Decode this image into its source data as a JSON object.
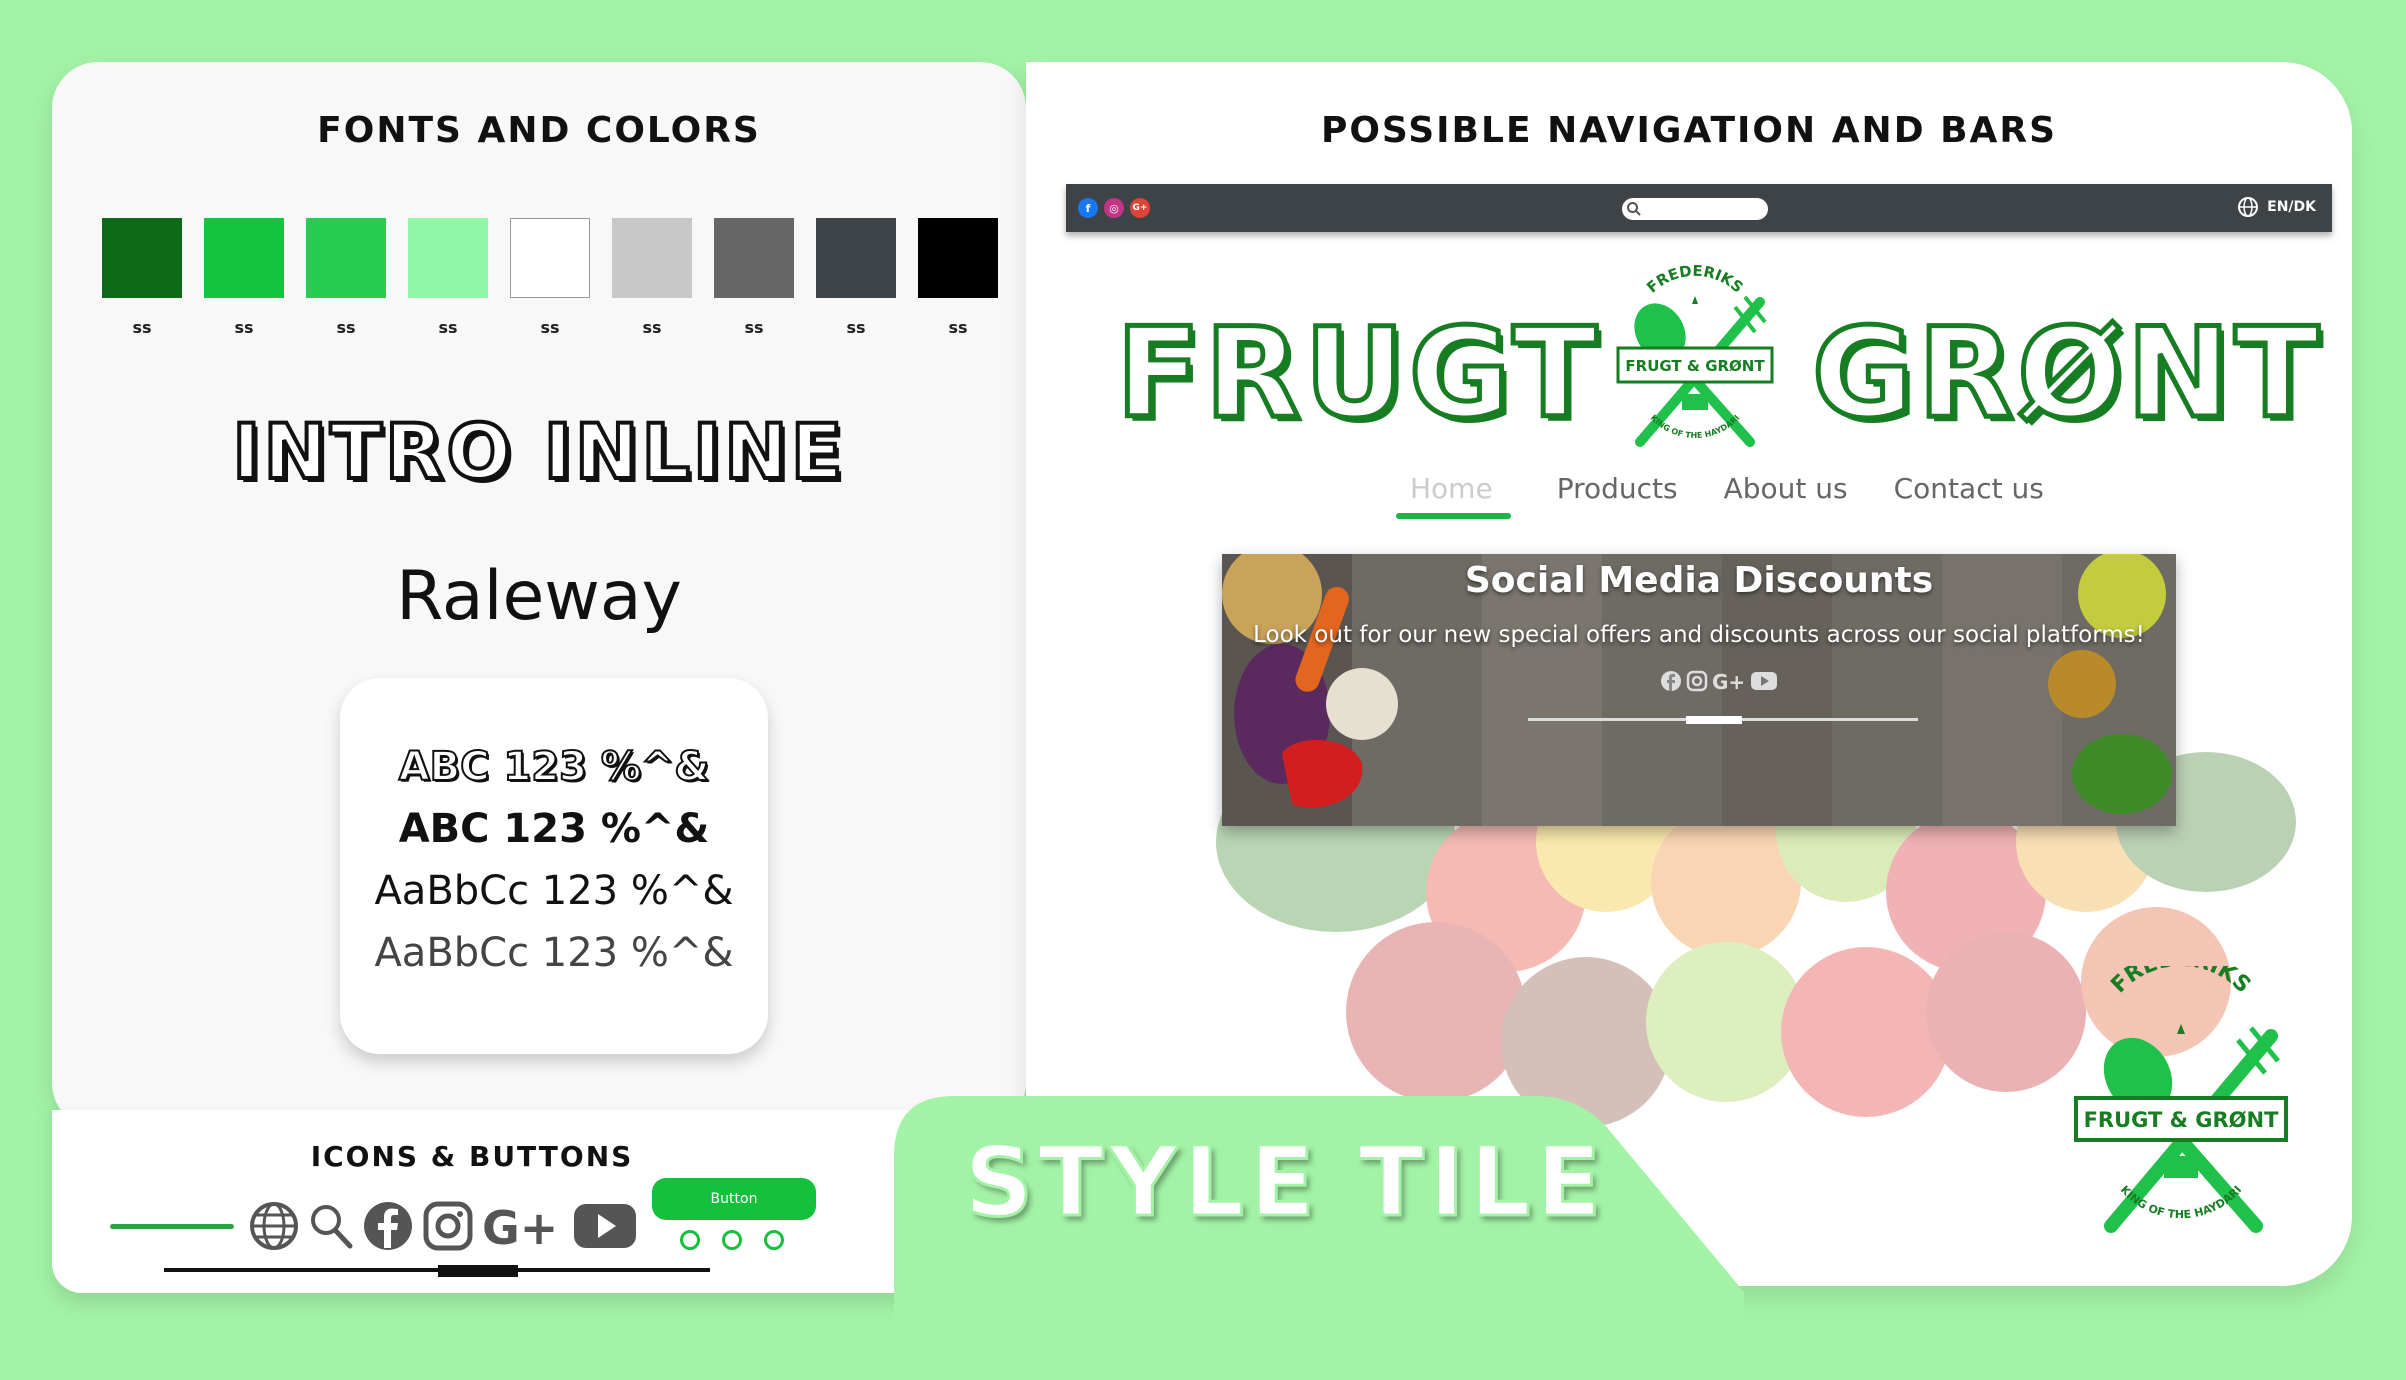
{
  "fonts_panel": {
    "title": "FONTS AND COLORS",
    "swatches": [
      {
        "color": "#0e6a17",
        "label": "ss"
      },
      {
        "color": "#14c43c",
        "label": "ss"
      },
      {
        "color": "#27cc52",
        "label": "ss"
      },
      {
        "color": "#8ff6a8",
        "label": "ss"
      },
      {
        "color": "#ffffff",
        "label": "ss"
      },
      {
        "color": "#c8c8c8",
        "label": "ss"
      },
      {
        "color": "#666666",
        "label": "ss"
      },
      {
        "color": "#3e4347",
        "label": "ss"
      },
      {
        "color": "#000000",
        "label": "ss"
      }
    ],
    "heading_font": "INTRO INLINE",
    "body_font": "Raleway",
    "samples": [
      "ABC 123 %^&",
      "ABC 123 %^&",
      "AaBbCc 123 %^&",
      "AaBbCc 123 %^&"
    ]
  },
  "icons_panel": {
    "title": "ICONS & BUTTONS",
    "icons": [
      "globe-icon",
      "search-icon",
      "facebook-icon",
      "instagram-icon",
      "google-plus-icon",
      "youtube-icon"
    ],
    "button_label": "Button"
  },
  "nav_panel": {
    "title": "POSSIBLE NAVIGATION AND BARS",
    "topbar": {
      "social": [
        "f",
        "◎",
        "G+"
      ],
      "language": "EN/DK"
    },
    "brand_left": "FRUGT",
    "brand_right": "GRØNT",
    "logo": {
      "arc_top": "FREDERIKS",
      "center": "FRUGT & GRØNT",
      "arc_bottom": "KING OF THE HAYDARI"
    },
    "menu": [
      "Home",
      "Products",
      "About us",
      "Contact us"
    ],
    "banner": {
      "title": "Social Media Discounts",
      "text": "Look out for our new special offers and discounts across our social platforms!"
    }
  },
  "tile": {
    "title": "STYLE TILE"
  },
  "colors": {
    "page_bg": "#a3f3a6",
    "accent": "#15c03d",
    "brand_dark": "#177d22",
    "bar": "#3e4347"
  }
}
